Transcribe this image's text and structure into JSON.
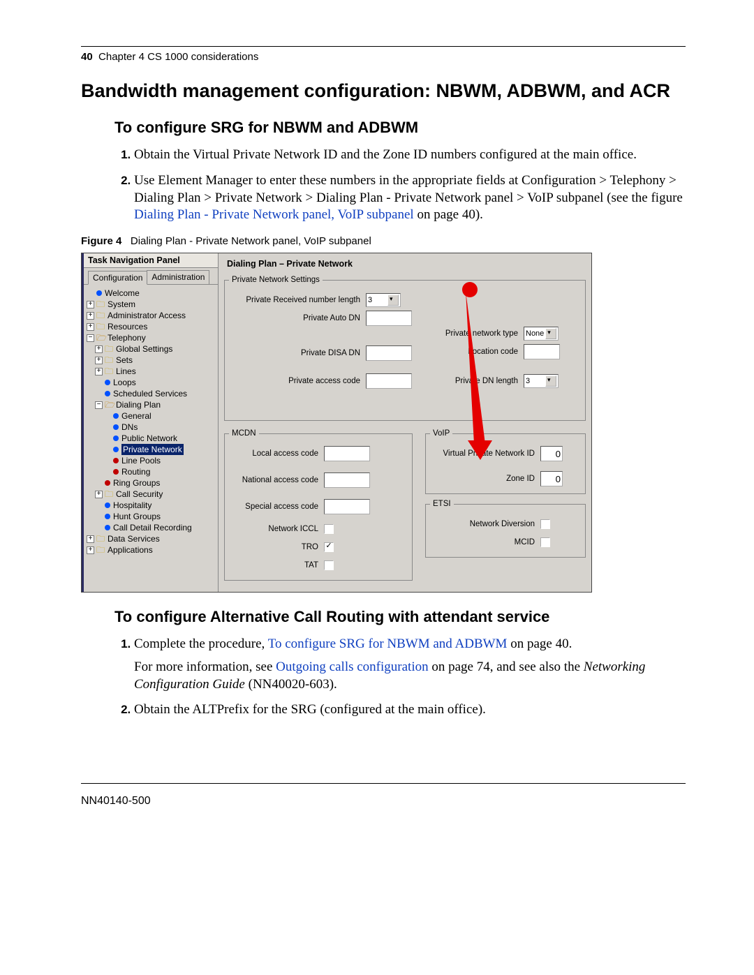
{
  "header": {
    "page_label": "40",
    "chapter": "Chapter 4  CS 1000 considerations"
  },
  "h1": "Bandwidth management configuration: NBWM, ADBWM, and ACR",
  "h2a": "To configure SRG for NBWM and ADBWM",
  "steps1": {
    "s1": "Obtain the Virtual Private Network ID and the Zone ID numbers configured at the main office.",
    "s2a": "Use Element Manager to enter these numbers in the appropriate fields at Configuration > Telephony > Dialing Plan > Private Network > Dialing Plan - Private Network panel > VoIP subpanel (see the figure ",
    "s2link": "Dialing Plan - Private Network panel, VoIP subpanel",
    "s2b": " on page 40)."
  },
  "figure": {
    "label": "Figure 4",
    "caption": "Dialing Plan - Private Network panel, VoIP subpanel"
  },
  "nav": {
    "panel_title": "Task Navigation Panel",
    "tab_config": "Configuration",
    "tab_admin": "Administration",
    "items": [
      "Welcome",
      "System",
      "Administrator Access",
      "Resources",
      "Telephony",
      "Global Settings",
      "Sets",
      "Lines",
      "Loops",
      "Scheduled Services",
      "Dialing Plan",
      "General",
      "DNs",
      "Public Network",
      "Private Network",
      "Line Pools",
      "Routing",
      "Ring Groups",
      "Call Security",
      "Hospitality",
      "Hunt Groups",
      "Call Detail Recording",
      "Data Services",
      "Applications"
    ]
  },
  "panel": {
    "title": "Dialing Plan – Private Network",
    "private_settings_legend": "Private Network Settings",
    "recv_len_label": "Private Received number length",
    "recv_len_value": "3",
    "auto_dn_label": "Private Auto DN",
    "disa_dn_label": "Private DISA DN",
    "access_code_label": "Private access code",
    "net_type_label": "Private network type",
    "net_type_value": "None",
    "loc_code_label": "Location code",
    "dn_len_label": "Private DN length",
    "dn_len_value": "3",
    "mcdn_legend": "MCDN",
    "mcdn_local": "Local access code",
    "mcdn_national": "National access code",
    "mcdn_special": "Special access code",
    "mcdn_iccl": "Network ICCL",
    "mcdn_tro": "TRO",
    "mcdn_tat": "TAT",
    "voip_legend": "VoIP",
    "voip_vpn": "Virtual Private Network ID",
    "voip_vpn_val": "0",
    "voip_zone": "Zone ID",
    "voip_zone_val": "0",
    "etsi_legend": "ETSI",
    "etsi_div": "Network Diversion",
    "etsi_mcid": "MCID"
  },
  "h2b": "To configure Alternative Call Routing with attendant service",
  "steps2": {
    "s1a": "Complete the procedure, ",
    "s1link": "To configure SRG for NBWM and ADBWM",
    "s1b": " on page 40.",
    "s1c_a": "For more information, see ",
    "s1c_link": "Outgoing calls configuration",
    "s1c_b": " on page 74, and see also the ",
    "s1c_i": "Networking Configuration Guide",
    "s1c_c": " (NN40020-603).",
    "s2": "Obtain the ALTPrefix for the SRG (configured at the main office)."
  },
  "footer": "NN40140-500"
}
